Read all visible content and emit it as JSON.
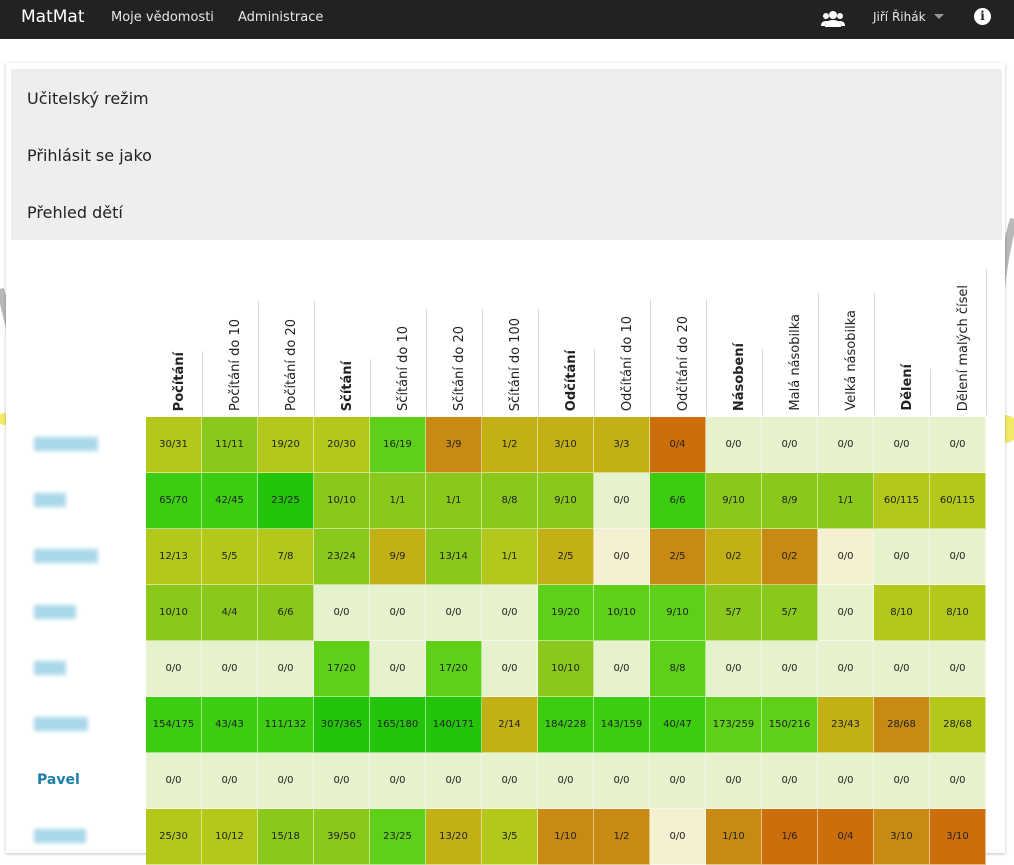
{
  "navbar": {
    "brand": "MatMat",
    "links": [
      "Moje vědomosti",
      "Administrace"
    ],
    "user": "Jiří Řihák",
    "icons": [
      "users-icon",
      "caret-down-icon",
      "info-icon"
    ]
  },
  "accordion": [
    "Učitelský režim",
    "Přihlásit se jako",
    "Přehled dětí"
  ],
  "columns": [
    {
      "label": "Počítání",
      "bold": true
    },
    {
      "label": "Počítání do 10",
      "bold": false
    },
    {
      "label": "Počítání do 20",
      "bold": false
    },
    {
      "label": "Sčítání",
      "bold": true
    },
    {
      "label": "Sčítání do 10",
      "bold": false
    },
    {
      "label": "Sčítání do 20",
      "bold": false
    },
    {
      "label": "Sčítání do 100",
      "bold": false
    },
    {
      "label": "Odčítání",
      "bold": true
    },
    {
      "label": "Odčítání do 10",
      "bold": false
    },
    {
      "label": "Odčítání do 20",
      "bold": false
    },
    {
      "label": "Násobení",
      "bold": true
    },
    {
      "label": "Malá násobilka",
      "bold": false
    },
    {
      "label": "Velká násobilka",
      "bold": false
    },
    {
      "label": "Dělení",
      "bold": true
    },
    {
      "label": "Dělení malých čísel",
      "bold": false
    }
  ],
  "colors": {
    "empty": "#e6f2cc",
    "palePeach": "#f5f0cf",
    "scale": [
      "#cc6e0a",
      "#c88a12",
      "#c3b014",
      "#b3c81a",
      "#8bc81c",
      "#5fd018",
      "#3ccd10",
      "#24c40a"
    ]
  },
  "students": [
    {
      "name": "",
      "blurred": true,
      "cells": [
        "30/31",
        "11/11",
        "19/20",
        "20/30",
        "16/19",
        "3/9",
        "1/2",
        "3/10",
        "3/3",
        "0/4",
        "0/0",
        "0/0",
        "0/0",
        "0/0",
        "0/0"
      ],
      "shades": [
        3,
        4,
        3,
        3,
        5,
        1,
        2,
        2,
        2,
        0,
        -1,
        -1,
        -1,
        -1,
        -1
      ]
    },
    {
      "name": "",
      "blurred": true,
      "cells": [
        "65/70",
        "42/45",
        "23/25",
        "10/10",
        "1/1",
        "1/1",
        "8/8",
        "9/10",
        "0/0",
        "6/6",
        "9/10",
        "8/9",
        "1/1",
        "60/115",
        "60/115"
      ],
      "shades": [
        6,
        6,
        7,
        4,
        4,
        4,
        4,
        4,
        -1,
        6,
        4,
        4,
        4,
        3,
        3
      ]
    },
    {
      "name": "",
      "blurred": true,
      "cells": [
        "12/13",
        "5/5",
        "7/8",
        "23/24",
        "9/9",
        "13/14",
        "1/1",
        "2/5",
        "0/0",
        "2/5",
        "0/2",
        "0/2",
        "0/0",
        "0/0",
        "0/0"
      ],
      "shades": [
        3,
        3,
        3,
        4,
        2,
        4,
        3,
        2,
        -2,
        1,
        2,
        1,
        -2,
        -1,
        -1
      ]
    },
    {
      "name": "",
      "blurred": true,
      "cells": [
        "10/10",
        "4/4",
        "6/6",
        "0/0",
        "0/0",
        "0/0",
        "0/0",
        "19/20",
        "10/10",
        "9/10",
        "5/7",
        "5/7",
        "0/0",
        "8/10",
        "8/10"
      ],
      "shades": [
        4,
        4,
        4,
        -1,
        -1,
        -1,
        -1,
        5,
        5,
        5,
        4,
        4,
        -1,
        3,
        3
      ]
    },
    {
      "name": "",
      "blurred": true,
      "cells": [
        "0/0",
        "0/0",
        "0/0",
        "17/20",
        "0/0",
        "17/20",
        "0/0",
        "10/10",
        "0/0",
        "8/8",
        "0/0",
        "0/0",
        "0/0",
        "0/0",
        "0/0"
      ],
      "shades": [
        -1,
        -1,
        -1,
        5,
        -1,
        5,
        -1,
        4,
        -1,
        5,
        -1,
        -1,
        -1,
        -1,
        -1
      ]
    },
    {
      "name": "",
      "blurred": true,
      "cells": [
        "154/175",
        "43/43",
        "111/132",
        "307/365",
        "165/180",
        "140/171",
        "2/14",
        "184/228",
        "143/159",
        "40/47",
        "173/259",
        "150/216",
        "23/43",
        "28/68",
        "28/68"
      ],
      "shades": [
        6,
        6,
        6,
        7,
        7,
        7,
        2,
        6,
        6,
        6,
        5,
        5,
        2,
        1,
        3
      ]
    },
    {
      "name": "Pavel",
      "blurred": false,
      "cells": [
        "0/0",
        "0/0",
        "0/0",
        "0/0",
        "0/0",
        "0/0",
        "0/0",
        "0/0",
        "0/0",
        "0/0",
        "0/0",
        "0/0",
        "0/0",
        "0/0",
        "0/0"
      ],
      "shades": [
        -1,
        -1,
        -1,
        -1,
        -1,
        -1,
        -1,
        -1,
        -1,
        -1,
        -1,
        -1,
        -1,
        -1,
        -1
      ]
    },
    {
      "name": "",
      "blurred": true,
      "cells": [
        "25/30",
        "10/12",
        "15/18",
        "39/50",
        "23/25",
        "13/20",
        "3/5",
        "1/10",
        "1/2",
        "0/0",
        "1/10",
        "1/6",
        "0/4",
        "3/10",
        "3/10"
      ],
      "shades": [
        3,
        3,
        4,
        4,
        5,
        2,
        3,
        1,
        1,
        -2,
        1,
        0,
        0,
        1,
        0
      ]
    }
  ]
}
